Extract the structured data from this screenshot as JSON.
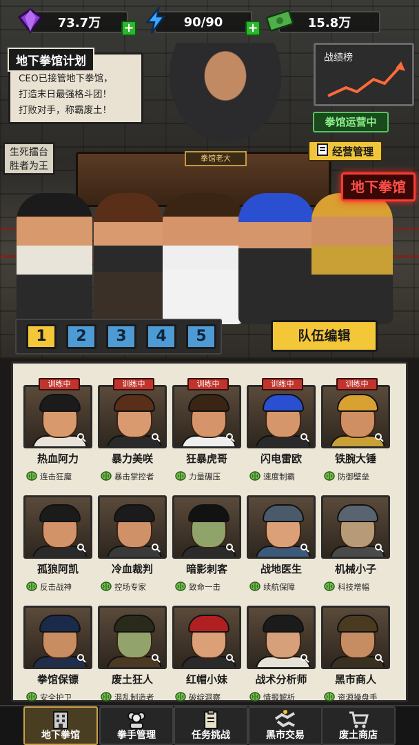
{
  "resources": [
    {
      "icon": "gem-icon",
      "value": "73.7万"
    },
    {
      "icon": "energy-icon",
      "value": "90/90"
    },
    {
      "icon": "cash-icon",
      "value": "15.8万"
    }
  ],
  "plan": {
    "title": "地下拳馆计划",
    "lines": [
      "CEO已接管地下拳馆，",
      "打造末日最强格斗团！",
      "打败对手，称霸废土！"
    ]
  },
  "sign": {
    "lines": [
      "生死擂台",
      "胜者为王"
    ]
  },
  "board": {
    "title": "战绩榜"
  },
  "status": "拳馆运营中",
  "manage_label": "经营管理",
  "neon_sign": "地下拳馆",
  "nameplate": "拳馆老大",
  "team_tabs": [
    "1",
    "2",
    "3",
    "4",
    "5"
  ],
  "team_active": 0,
  "edit_label": "队伍编辑",
  "training_label": "训练中",
  "fighters": [
    {
      "name": "热血阿力",
      "skill": "连击狂魔",
      "training": true,
      "hair": "#1b1b1b",
      "skin": "#d89a6c",
      "shirt": "#e8e4da"
    },
    {
      "name": "暴力美咲",
      "skill": "暴击掌控者",
      "training": true,
      "hair": "#5a2f1a",
      "skin": "#d99a70",
      "shirt": "#2a2a2a"
    },
    {
      "name": "狂暴虎哥",
      "skill": "力量碾压",
      "training": true,
      "hair": "#3a2414",
      "skin": "#d6946a",
      "shirt": "#efefef"
    },
    {
      "name": "闪电雷欧",
      "skill": "速度制霸",
      "training": true,
      "hair": "#2a4fd0",
      "skin": "#d5966c",
      "shirt": "#2a2a2a"
    },
    {
      "name": "铁腕大锤",
      "skill": "防御壁垒",
      "training": true,
      "hair": "#d9a032",
      "skin": "#cf8f62",
      "shirt": "#c8a036"
    },
    {
      "name": "孤狼阿凯",
      "skill": "反击战神",
      "training": false,
      "hair": "#1b1b1b",
      "skin": "#d39368",
      "shirt": "#2a2a2a"
    },
    {
      "name": "冷血裁判",
      "skill": "控场专家",
      "training": false,
      "hair": "#1b1b1b",
      "skin": "#cf9168",
      "shirt": "#3a3a3a"
    },
    {
      "name": "暗影刺客",
      "skill": "致命一击",
      "training": false,
      "hair": "#121212",
      "skin": "#8fa36a",
      "shirt": "#2b2b2b"
    },
    {
      "name": "战地医生",
      "skill": "续航保障",
      "training": false,
      "hair": "#4a5a6a",
      "skin": "#dca078",
      "shirt": "#3b5a7a"
    },
    {
      "name": "机械小子",
      "skill": "科技增幅",
      "training": false,
      "hair": "#5a6470",
      "skin": "#b79a78",
      "shirt": "#4a4a4a"
    },
    {
      "name": "拳馆保镖",
      "skill": "安全护卫",
      "training": false,
      "hair": "#1a2a4a",
      "skin": "#c98d62",
      "shirt": "#1f2e4a"
    },
    {
      "name": "废土狂人",
      "skill": "混乱制造者",
      "training": false,
      "hair": "#2a2a1a",
      "skin": "#93a36c",
      "shirt": "#4a3a24"
    },
    {
      "name": "红帽小妹",
      "skill": "破绽洞察",
      "training": false,
      "hair": "#b02020",
      "skin": "#dca078",
      "shirt": "#2a2a2a"
    },
    {
      "name": "战术分析师",
      "skill": "情报解析",
      "training": false,
      "hair": "#1b1b1b",
      "skin": "#d6a07a",
      "shirt": "#e6e2d8"
    },
    {
      "name": "黑市商人",
      "skill": "资源操盘手",
      "training": false,
      "hair": "#4a3a20",
      "skin": "#c68c62",
      "shirt": "#3a3020"
    }
  ],
  "nav": [
    {
      "label": "地下拳馆",
      "icon": "building-icon",
      "active": true
    },
    {
      "label": "拳手管理",
      "icon": "team-icon",
      "active": false
    },
    {
      "label": "任务挑战",
      "icon": "clipboard-icon",
      "active": false
    },
    {
      "label": "黑市交易",
      "icon": "handshake-icon",
      "active": false
    },
    {
      "label": "废土商店",
      "icon": "cart-icon",
      "active": false
    }
  ]
}
